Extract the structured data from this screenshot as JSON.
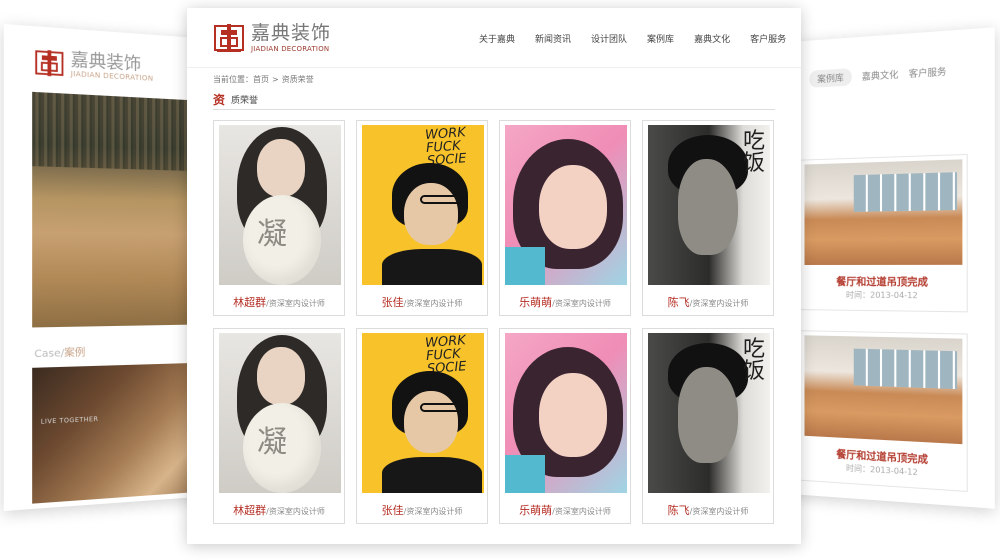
{
  "brand": {
    "name": "嘉典装饰",
    "subtitle": "JIADIAN DECORATION",
    "color": "#b52f23"
  },
  "nav": [
    "关于嘉典",
    "新闻资讯",
    "设计团队",
    "案例库",
    "嘉典文化",
    "客户服务"
  ],
  "breadcrumb": {
    "prefix": "当前位置：",
    "home": "首页",
    "separator": ">",
    "current": "资质荣誉"
  },
  "section": {
    "icon_char": "资",
    "title": "质荣誉"
  },
  "team": [
    {
      "name": "林超群",
      "role": "/资深室内设计师",
      "balloon_text": "凝"
    },
    {
      "name": "张佳",
      "role": "/资深室内设计师",
      "poster_text": "WORK FUCK SOCIE"
    },
    {
      "name": "乐萌萌",
      "role": "/资深室内设计师"
    },
    {
      "name": "陈飞",
      "role": "/资深室内设计师",
      "poster_text": "吃饭"
    },
    {
      "name": "林超群",
      "role": "/资深室内设计师",
      "balloon_text": "凝"
    },
    {
      "name": "张佳",
      "role": "/资深室内设计师",
      "poster_text": "WORK FUCK SOCIE"
    },
    {
      "name": "乐萌萌",
      "role": "/资深室内设计师"
    },
    {
      "name": "陈飞",
      "role": "/资深室内设计师",
      "poster_text": "吃饭"
    }
  ],
  "left_preview": {
    "brand": "嘉典装饰",
    "brand_sub": "JIADIAN DECORATION",
    "case_label_en": "Case/",
    "case_label_cn": "案例",
    "photo_caption": "LIVE TOGETHER"
  },
  "right_preview": {
    "nav": [
      "案例库",
      "嘉典文化",
      "客户服务"
    ],
    "items": [
      {
        "title": "餐厅和过道吊顶完成",
        "date": "时间：2013-04-12"
      },
      {
        "title": "餐厅和过道吊顶完成",
        "date": "时间：2013-04-12"
      }
    ]
  }
}
